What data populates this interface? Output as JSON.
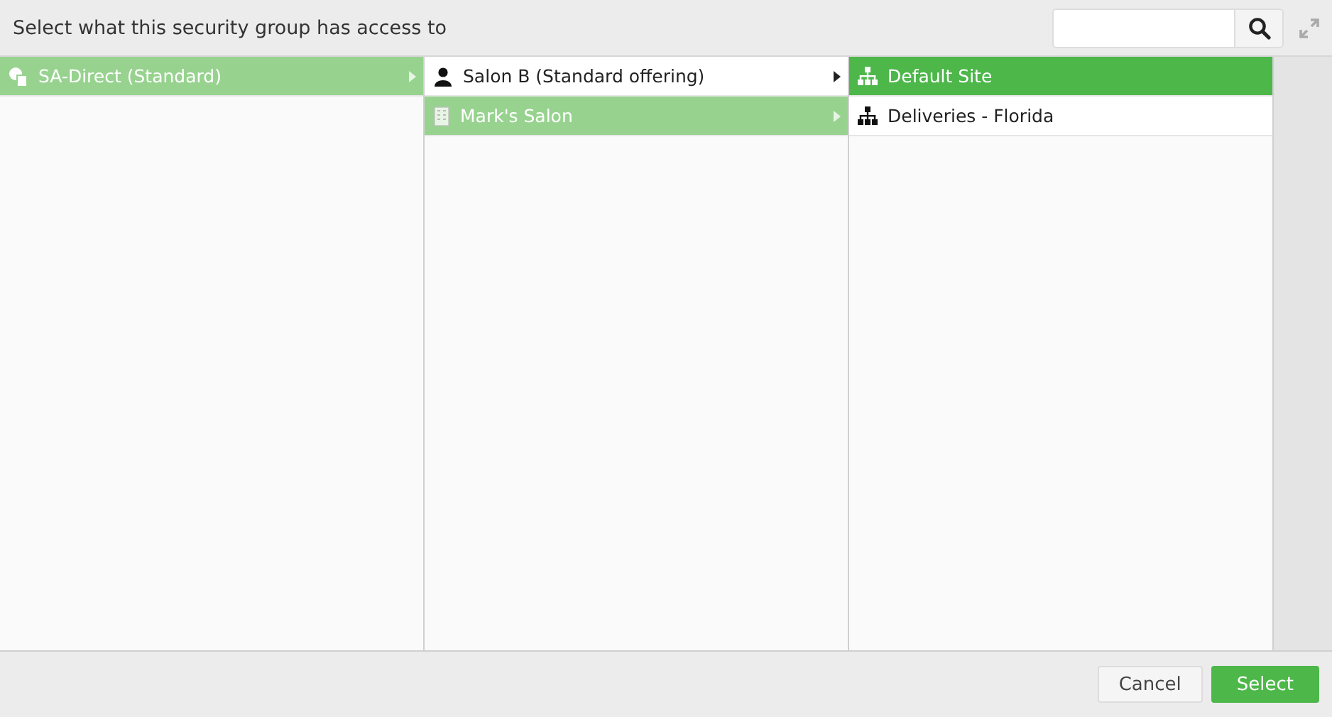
{
  "title": "Select what this security group has access to",
  "columns": [
    {
      "current": false,
      "items": [
        {
          "kind": "org",
          "label": "SA-Direct (Standard)",
          "selected": true,
          "has_children": true
        }
      ]
    },
    {
      "current": false,
      "items": [
        {
          "kind": "person",
          "label": "Salon B (Standard offering)",
          "selected": false,
          "has_children": true
        },
        {
          "kind": "building",
          "label": "Mark's Salon",
          "selected": true,
          "has_children": true
        }
      ]
    },
    {
      "current": true,
      "items": [
        {
          "kind": "site",
          "label": "Default Site",
          "selected": true,
          "has_children": false
        },
        {
          "kind": "site",
          "label": "Deliveries - Florida",
          "selected": false,
          "has_children": false
        }
      ]
    }
  ],
  "buttons": [
    {
      "kind": "secondary",
      "label": "Cancel"
    },
    {
      "kind": "primary",
      "label": "Select"
    }
  ]
}
